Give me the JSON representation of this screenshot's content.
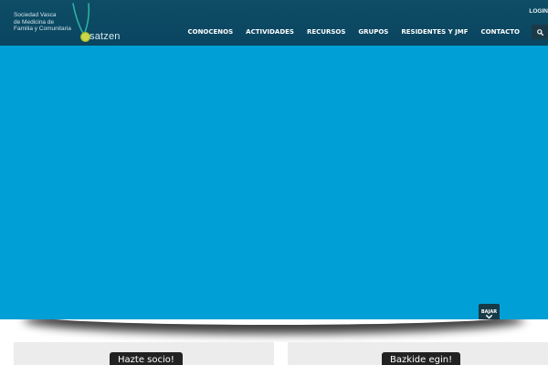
{
  "logo": {
    "tagline_lines": [
      "Sociedad Vasca",
      "de Medicina de",
      "Familia y Comunitaria"
    ],
    "wordmark": "satzen",
    "accent_color": "#c8d84a",
    "icon": "osatzen-swoosh-logo"
  },
  "header": {
    "login_label": "LOGIN",
    "nav_items": [
      {
        "label": "CONOCENOS"
      },
      {
        "label": "ACTIVIDADES"
      },
      {
        "label": "RECURSOS"
      },
      {
        "label": "GRUPOS"
      },
      {
        "label": "RESIDENTES Y JMF"
      },
      {
        "label": "CONTACTO"
      }
    ],
    "search_icon": "search-icon",
    "background_color": "#0a4560"
  },
  "hero": {
    "background_color": "#009fd6",
    "scroll_button": {
      "label": "BAJAR",
      "icon": "chevron-down-icon"
    }
  },
  "panels": {
    "left_button_label": "Hazte socio!",
    "right_button_label": "Bazkide egin!"
  }
}
